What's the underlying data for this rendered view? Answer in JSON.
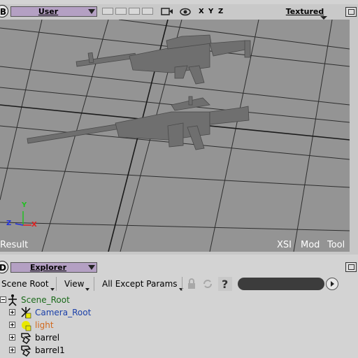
{
  "viewport": {
    "letter": "B",
    "camera": "User",
    "axes": [
      "X",
      "Y",
      "Z"
    ],
    "display_mode": "Textured",
    "overlay": {
      "left": "Result",
      "right": [
        "XSI",
        "Mod",
        "Tool"
      ]
    },
    "gizmo": {
      "x": "X",
      "y": "Y",
      "z": "Z"
    },
    "colors": {
      "scene_bg": "#949494",
      "grid": "#2b2b2b",
      "model": "#6f6f6f"
    }
  },
  "explorer": {
    "letter": "D",
    "title": "Explorer",
    "toolbar": {
      "scope": "Scene Root",
      "view": "View",
      "filter": "All Except Params"
    },
    "tree": [
      {
        "label": "Scene_Root",
        "icon": "scene-root-icon",
        "color": "#1a6a1a",
        "expander": "minus",
        "indent": 0
      },
      {
        "label": "Camera_Root",
        "icon": "camera-root-icon",
        "color": "#1a3fa8",
        "expander": "plus",
        "indent": 1
      },
      {
        "label": "light",
        "icon": "light-icon",
        "color": "#d2691e",
        "expander": "plus",
        "indent": 1
      },
      {
        "label": "barrel",
        "icon": "polymesh-icon",
        "color": "#000000",
        "expander": "plus",
        "indent": 1
      },
      {
        "label": "barrel1",
        "icon": "polymesh-icon",
        "color": "#000000",
        "expander": "plus",
        "indent": 1
      }
    ]
  }
}
